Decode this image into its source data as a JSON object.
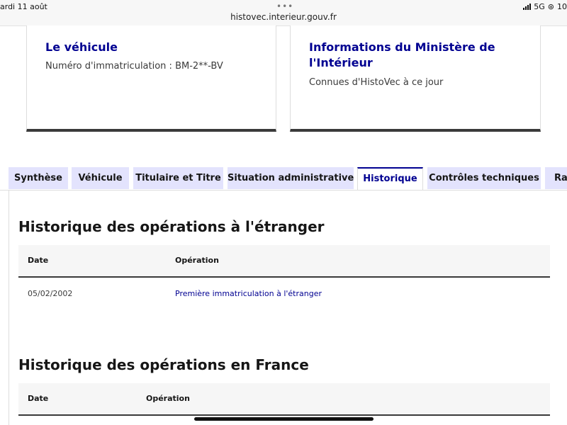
{
  "status_bar": {
    "date": "ardi 11 août",
    "url": "histovec.interieur.gouv.fr",
    "network": "5G",
    "battery": "10"
  },
  "cards": [
    {
      "title": "Le véhicule",
      "text": "Numéro d'immatriculation : BM-2**-BV"
    },
    {
      "title": "Informations du Ministère de l'Intérieur",
      "text": "Connues d'HistoVec à ce jour"
    }
  ],
  "tabs": [
    {
      "label": "Synthèse"
    },
    {
      "label": "Véhicule"
    },
    {
      "label": "Titulaire et Titre"
    },
    {
      "label": "Situation administrative"
    },
    {
      "label": "Historique",
      "active": true
    },
    {
      "label": "Contrôles techniques"
    },
    {
      "label": "Rap"
    }
  ],
  "sections": [
    {
      "title": "Historique des opérations à l'étranger",
      "columns": [
        "Date",
        "Opération"
      ],
      "rows": [
        {
          "date": "05/02/2002",
          "operation": "Première immatriculation à l'étranger"
        }
      ]
    },
    {
      "title": "Historique des opérations en France",
      "columns": [
        "Date",
        "Opération"
      ],
      "rows": []
    }
  ],
  "colors": {
    "accent": "#000091",
    "tab_bg": "#e3e3fd",
    "table_header_bg": "#f6f6f6"
  }
}
